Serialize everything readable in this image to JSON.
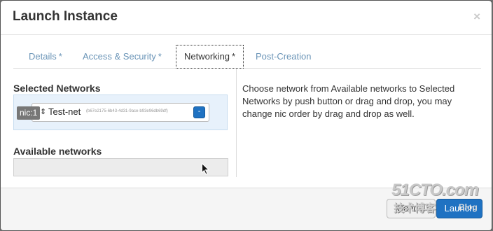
{
  "modal": {
    "title": "Launch Instance",
    "close_glyph": "×"
  },
  "tabs": [
    {
      "label": "Details",
      "required": "*",
      "active": false
    },
    {
      "label": "Access & Security",
      "required": "*",
      "active": false
    },
    {
      "label": "Networking",
      "required": "*",
      "active": true
    },
    {
      "label": "Post-Creation",
      "required": "",
      "active": false
    }
  ],
  "networking": {
    "selected_label": "Selected Networks",
    "available_label": "Available networks",
    "selected_networks": [
      {
        "nic": "nic:1",
        "name": "Test-net",
        "id": "(b67e2175-6b43-4d31-9ace-b93e96db69df)",
        "remove_glyph": "-"
      }
    ],
    "help_text": "Choose network from Available networks to Selected Networks by push button or drag and drop, you may change nic order by drag and drop as well."
  },
  "footer": {
    "cancel_label": "Cancel",
    "launch_label": "Launch"
  },
  "watermark": {
    "site": "51CTO.com",
    "sub": "技术博客",
    "blog": "Blog"
  },
  "colors": {
    "accent": "#1f72c2",
    "tab_link": "#6a94b7",
    "selected_bg": "#e7f1fb"
  }
}
